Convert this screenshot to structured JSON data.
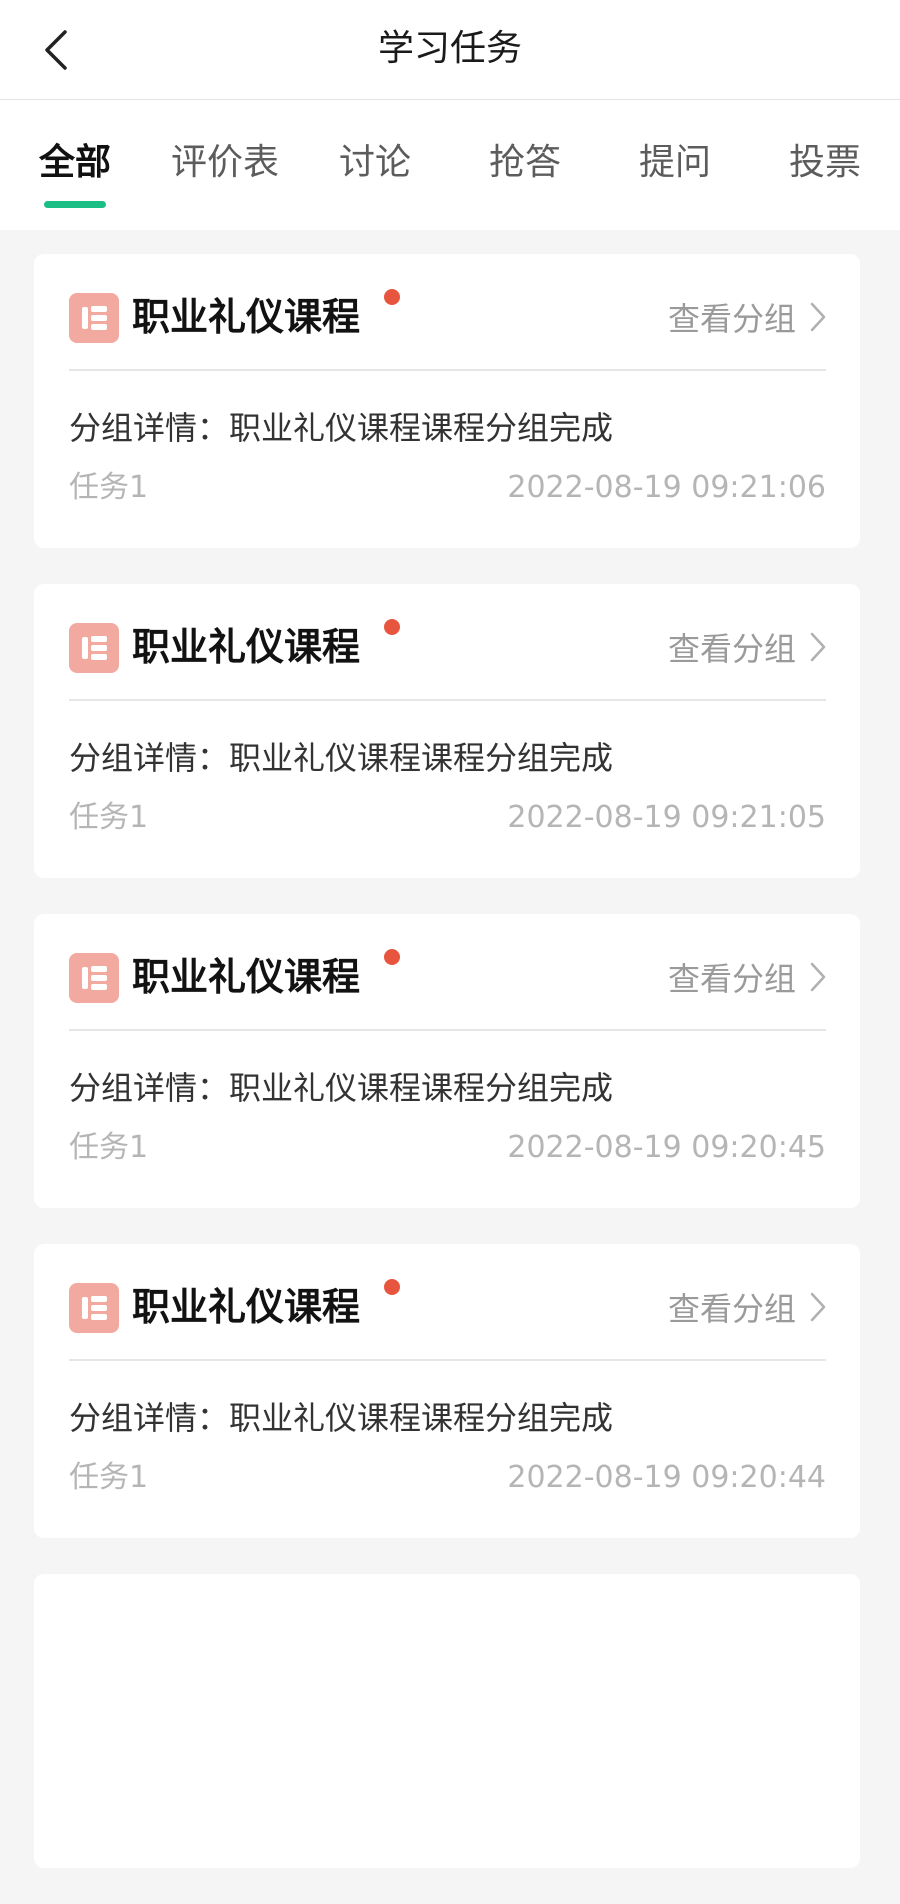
{
  "header": {
    "title": "学习任务",
    "back_icon": "back-arrow-icon"
  },
  "tabs": [
    {
      "label": "全部",
      "active": true
    },
    {
      "label": "评价表",
      "active": false
    },
    {
      "label": "讨论",
      "active": false
    },
    {
      "label": "抢答",
      "active": false
    },
    {
      "label": "提问",
      "active": false
    },
    {
      "label": "投票",
      "active": false
    }
  ],
  "colors": {
    "accent": "#1bbf86",
    "dot": "#e8553f",
    "icon_bg": "#f2aaa0",
    "background": "#f5f5f5"
  },
  "cards": [
    {
      "title": "职业礼仪课程",
      "action": "查看分组",
      "detail": "分组详情：职业礼仪课程课程分组完成",
      "task": "任务1",
      "time": "2022-08-19 09:21:06"
    },
    {
      "title": "职业礼仪课程",
      "action": "查看分组",
      "detail": "分组详情：职业礼仪课程课程分组完成",
      "task": "任务1",
      "time": "2022-08-19 09:21:05"
    },
    {
      "title": "职业礼仪课程",
      "action": "查看分组",
      "detail": "分组详情：职业礼仪课程课程分组完成",
      "task": "任务1",
      "time": "2022-08-19 09:20:45"
    },
    {
      "title": "职业礼仪课程",
      "action": "查看分组",
      "detail": "分组详情：职业礼仪课程课程分组完成",
      "task": "任务1",
      "time": "2022-08-19 09:20:44"
    },
    {
      "title": "",
      "action": "",
      "detail": "",
      "task": "",
      "time": ""
    }
  ]
}
